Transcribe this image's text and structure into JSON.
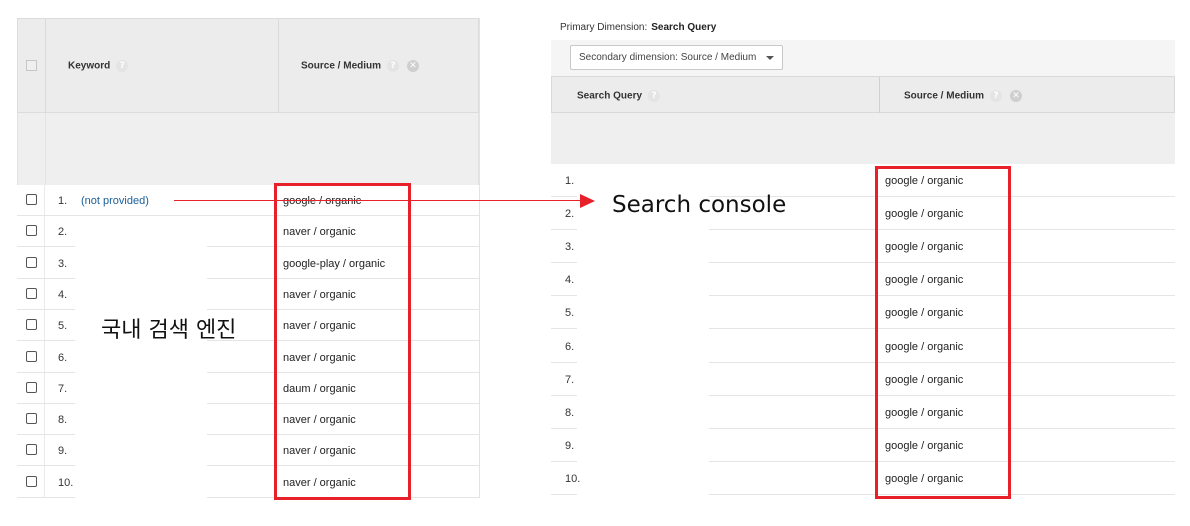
{
  "left_table": {
    "header": {
      "keyword": "Keyword",
      "source_medium": "Source / Medium",
      "help_glyph": "?",
      "remove_glyph": "✕"
    },
    "rows": [
      {
        "num": "1.",
        "keyword": "(not provided)",
        "source": "google / organic"
      },
      {
        "num": "2.",
        "keyword": "",
        "source": "naver / organic"
      },
      {
        "num": "3.",
        "keyword": "",
        "source": "google-play / organic"
      },
      {
        "num": "4.",
        "keyword": "",
        "source": "naver / organic"
      },
      {
        "num": "5.",
        "keyword": "",
        "source": "naver / organic"
      },
      {
        "num": "6.",
        "keyword": "",
        "source": "naver / organic"
      },
      {
        "num": "7.",
        "keyword": "",
        "source": "daum / organic"
      },
      {
        "num": "8.",
        "keyword": "",
        "source": "naver / organic"
      },
      {
        "num": "9.",
        "keyword": "",
        "source": "naver / organic"
      },
      {
        "num": "10.",
        "keyword": "",
        "source": "naver / organic"
      }
    ]
  },
  "right_table": {
    "primary_dimension_label": "Primary Dimension:",
    "primary_dimension_value": "Search Query",
    "secondary_dimension": "Secondary dimension: Source / Medium",
    "header": {
      "search_query": "Search Query",
      "source_medium": "Source / Medium",
      "help_glyph": "?",
      "remove_glyph": "✕"
    },
    "rows": [
      {
        "num": "1.",
        "source": "google / organic"
      },
      {
        "num": "2.",
        "source": "google / organic"
      },
      {
        "num": "3.",
        "source": "google / organic"
      },
      {
        "num": "4.",
        "source": "google / organic"
      },
      {
        "num": "5.",
        "source": "google / organic"
      },
      {
        "num": "6.",
        "source": "google / organic"
      },
      {
        "num": "7.",
        "source": "google / organic"
      },
      {
        "num": "8.",
        "source": "google / organic"
      },
      {
        "num": "9.",
        "source": "google / organic"
      },
      {
        "num": "10.",
        "source": "google / organic"
      }
    ]
  },
  "annotations": {
    "search_console": "Search console",
    "domestic_engines": "국내 검색 엔진",
    "highlight_color": "#e8202a"
  },
  "colors": {
    "link": "#1a5f99",
    "header_bg": "#ececec"
  }
}
